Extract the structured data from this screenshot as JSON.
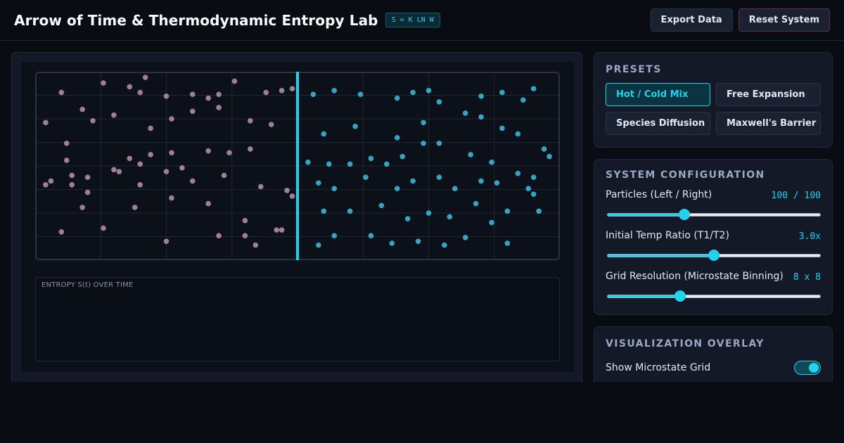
{
  "header": {
    "title": "Arrow of Time & Thermodynamic Entropy Lab",
    "formula_badge": "S = K LN W",
    "export_label": "Export Data",
    "reset_label": "Reset System"
  },
  "simulation": {
    "entropy_label": "ENTROPY S(t) OVER TIME",
    "grid_cells": 8,
    "colors": {
      "hot": "#b08aac",
      "cold": "#3ab4d4",
      "barrier": "#22d3ee",
      "accent": "#22d3ee"
    },
    "left_particles": [
      [
        0.05,
        0.11
      ],
      [
        0.09,
        0.2
      ],
      [
        0.13,
        0.06
      ],
      [
        0.18,
        0.08
      ],
      [
        0.2,
        0.11
      ],
      [
        0.21,
        0.03
      ],
      [
        0.25,
        0.13
      ],
      [
        0.3,
        0.12
      ],
      [
        0.33,
        0.14
      ],
      [
        0.38,
        0.05
      ],
      [
        0.44,
        0.11
      ],
      [
        0.47,
        0.1
      ],
      [
        0.49,
        0.09
      ],
      [
        0.02,
        0.27
      ],
      [
        0.06,
        0.38
      ],
      [
        0.11,
        0.26
      ],
      [
        0.15,
        0.23
      ],
      [
        0.22,
        0.3
      ],
      [
        0.26,
        0.25
      ],
      [
        0.3,
        0.21
      ],
      [
        0.35,
        0.19
      ],
      [
        0.41,
        0.26
      ],
      [
        0.45,
        0.28
      ],
      [
        0.06,
        0.47
      ],
      [
        0.07,
        0.55
      ],
      [
        0.1,
        0.56
      ],
      [
        0.15,
        0.52
      ],
      [
        0.18,
        0.46
      ],
      [
        0.2,
        0.49
      ],
      [
        0.22,
        0.44
      ],
      [
        0.26,
        0.43
      ],
      [
        0.28,
        0.51
      ],
      [
        0.33,
        0.42
      ],
      [
        0.37,
        0.43
      ],
      [
        0.41,
        0.41
      ],
      [
        0.03,
        0.58
      ],
      [
        0.07,
        0.6
      ],
      [
        0.1,
        0.64
      ],
      [
        0.16,
        0.53
      ],
      [
        0.2,
        0.6
      ],
      [
        0.25,
        0.53
      ],
      [
        0.3,
        0.58
      ],
      [
        0.36,
        0.55
      ],
      [
        0.43,
        0.61
      ],
      [
        0.48,
        0.63
      ],
      [
        0.09,
        0.72
      ],
      [
        0.19,
        0.72
      ],
      [
        0.26,
        0.67
      ],
      [
        0.33,
        0.7
      ],
      [
        0.4,
        0.79
      ],
      [
        0.46,
        0.84
      ],
      [
        0.49,
        0.66
      ],
      [
        0.05,
        0.85
      ],
      [
        0.13,
        0.83
      ],
      [
        0.25,
        0.9
      ],
      [
        0.35,
        0.87
      ],
      [
        0.4,
        0.87
      ],
      [
        0.42,
        0.92
      ],
      [
        0.47,
        0.84
      ],
      [
        0.02,
        0.6
      ],
      [
        0.35,
        0.12
      ]
    ],
    "right_particles": [
      [
        0.53,
        0.12
      ],
      [
        0.57,
        0.1
      ],
      [
        0.62,
        0.12
      ],
      [
        0.69,
        0.14
      ],
      [
        0.72,
        0.11
      ],
      [
        0.75,
        0.1
      ],
      [
        0.77,
        0.16
      ],
      [
        0.85,
        0.13
      ],
      [
        0.89,
        0.11
      ],
      [
        0.93,
        0.15
      ],
      [
        0.95,
        0.09
      ],
      [
        0.55,
        0.33
      ],
      [
        0.61,
        0.29
      ],
      [
        0.69,
        0.35
      ],
      [
        0.74,
        0.27
      ],
      [
        0.77,
        0.38
      ],
      [
        0.82,
        0.22
      ],
      [
        0.85,
        0.24
      ],
      [
        0.89,
        0.3
      ],
      [
        0.92,
        0.33
      ],
      [
        0.97,
        0.41
      ],
      [
        0.52,
        0.48
      ],
      [
        0.56,
        0.49
      ],
      [
        0.6,
        0.49
      ],
      [
        0.64,
        0.46
      ],
      [
        0.67,
        0.49
      ],
      [
        0.7,
        0.45
      ],
      [
        0.74,
        0.38
      ],
      [
        0.83,
        0.44
      ],
      [
        0.87,
        0.48
      ],
      [
        0.92,
        0.54
      ],
      [
        0.95,
        0.56
      ],
      [
        0.54,
        0.59
      ],
      [
        0.57,
        0.62
      ],
      [
        0.63,
        0.56
      ],
      [
        0.69,
        0.62
      ],
      [
        0.72,
        0.58
      ],
      [
        0.77,
        0.56
      ],
      [
        0.8,
        0.62
      ],
      [
        0.85,
        0.58
      ],
      [
        0.88,
        0.59
      ],
      [
        0.94,
        0.62
      ],
      [
        0.55,
        0.74
      ],
      [
        0.6,
        0.74
      ],
      [
        0.66,
        0.71
      ],
      [
        0.71,
        0.78
      ],
      [
        0.75,
        0.75
      ],
      [
        0.79,
        0.77
      ],
      [
        0.84,
        0.7
      ],
      [
        0.87,
        0.8
      ],
      [
        0.9,
        0.74
      ],
      [
        0.95,
        0.65
      ],
      [
        0.54,
        0.92
      ],
      [
        0.57,
        0.87
      ],
      [
        0.64,
        0.87
      ],
      [
        0.68,
        0.91
      ],
      [
        0.73,
        0.9
      ],
      [
        0.78,
        0.92
      ],
      [
        0.82,
        0.88
      ],
      [
        0.9,
        0.91
      ],
      [
        0.96,
        0.74
      ],
      [
        0.98,
        0.45
      ]
    ]
  },
  "presets": {
    "title": "Presets",
    "items": [
      {
        "label": "Hot / Cold Mix",
        "active": true
      },
      {
        "label": "Free Expansion",
        "active": false
      },
      {
        "label": "Species Diffusion",
        "active": false
      },
      {
        "label": "Maxwell's Barrier",
        "active": false
      }
    ]
  },
  "config": {
    "title": "System Configuration",
    "particles": {
      "label": "Particles (Left / Right)",
      "value": "100 / 100",
      "level": 0.36
    },
    "temp_ratio": {
      "label": "Initial Temp Ratio (T1/T2)",
      "value": "3.0x",
      "level": 0.5
    },
    "grid": {
      "label": "Grid Resolution (Microstate Binning)",
      "value": "8 x 8",
      "level": 0.34
    }
  },
  "overlay": {
    "title": "Visualization Overlay",
    "show_grid_label": "Show Microstate Grid",
    "show_grid_on": true
  }
}
